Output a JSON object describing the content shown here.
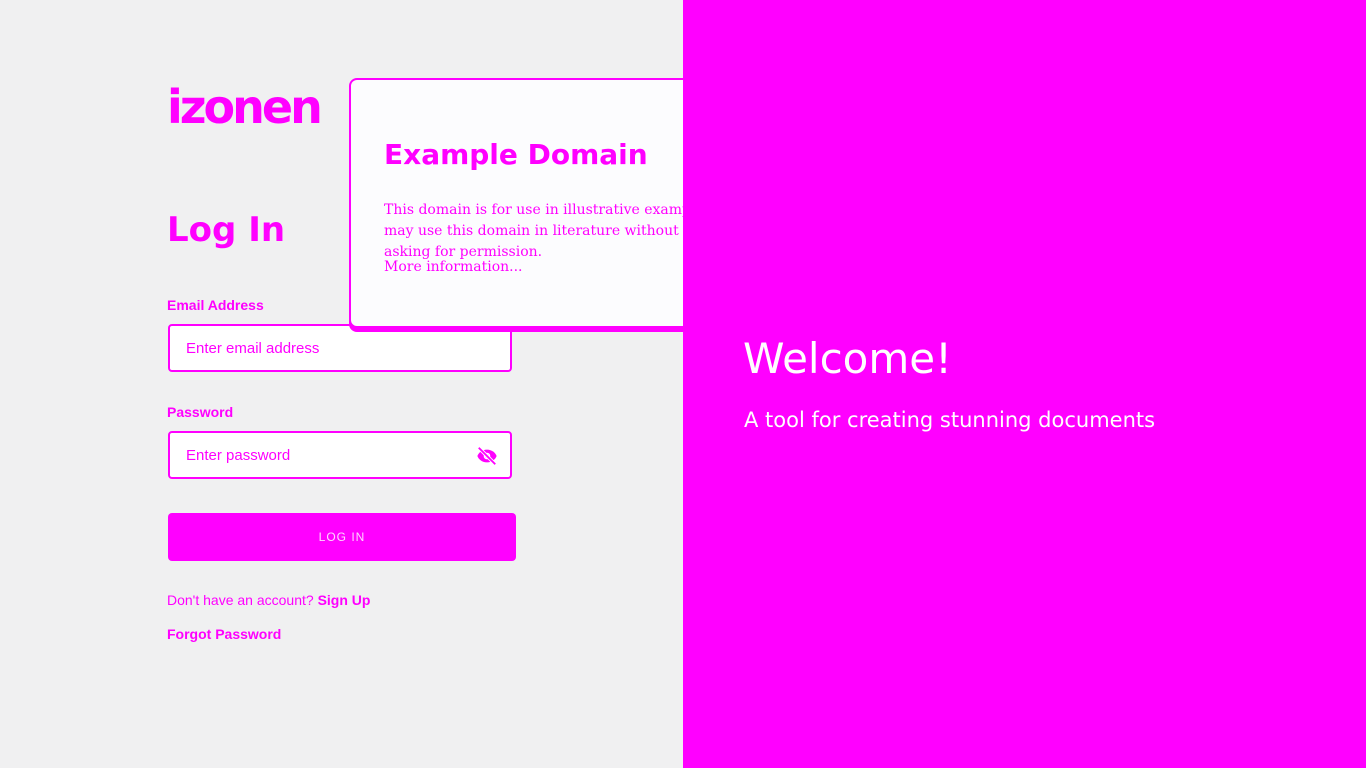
{
  "brand": {
    "logo_text": "izonen",
    "accent_color": "#ff00ff"
  },
  "login": {
    "title": "Log In",
    "email_label": "Email Address",
    "email_placeholder": "Enter email address",
    "email_value": "",
    "password_label": "Password",
    "password_placeholder": "Enter password",
    "password_value": "",
    "password_toggle_icon": "eye-slash-icon",
    "button_label": "LOG IN",
    "signup_prompt": "Don't have an account?",
    "signup_link": "Sign Up",
    "forgot_link": "Forgot Password"
  },
  "popup": {
    "title": "Example Domain",
    "body": "This domain is for use in illustrative examples in documents. You may use this domain in literature without prior coordination or asking for permission.",
    "link": "More information..."
  },
  "welcome": {
    "title": "Welcome!",
    "subtitle": "A tool for creating stunning documents"
  }
}
